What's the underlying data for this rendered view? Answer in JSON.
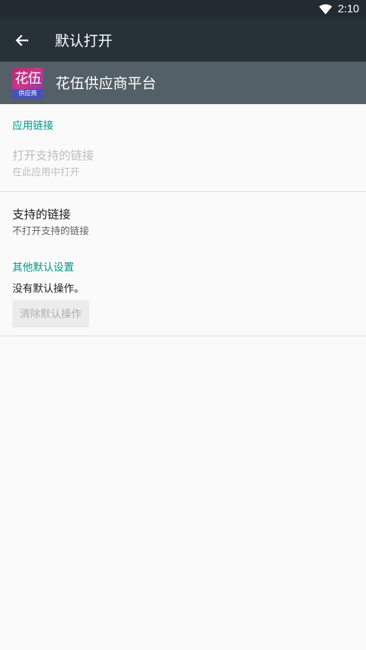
{
  "status_bar": {
    "time": "2:10",
    "wifi_icon": "wifi-icon"
  },
  "toolbar": {
    "title": "默认打开",
    "back_icon": "arrow-back-icon"
  },
  "app": {
    "name": "花伍供应商平台",
    "icon_text": "花伍",
    "icon_band_text": "供应商"
  },
  "app_links": {
    "section_title": "应用链接",
    "open_supported": {
      "title": "打开支持的链接",
      "summary": "在此应用中打开"
    },
    "supported_links": {
      "title": "支持的链接",
      "summary": "不打开支持的链接"
    }
  },
  "other_defaults": {
    "section_title": "其他默认设置",
    "summary": "没有默认操作。",
    "clear_button_label": "清除默认操作"
  },
  "colors": {
    "accent": "#009688",
    "toolbar": "#263238",
    "status_bar": "#212b30",
    "app_header": "#546067"
  }
}
